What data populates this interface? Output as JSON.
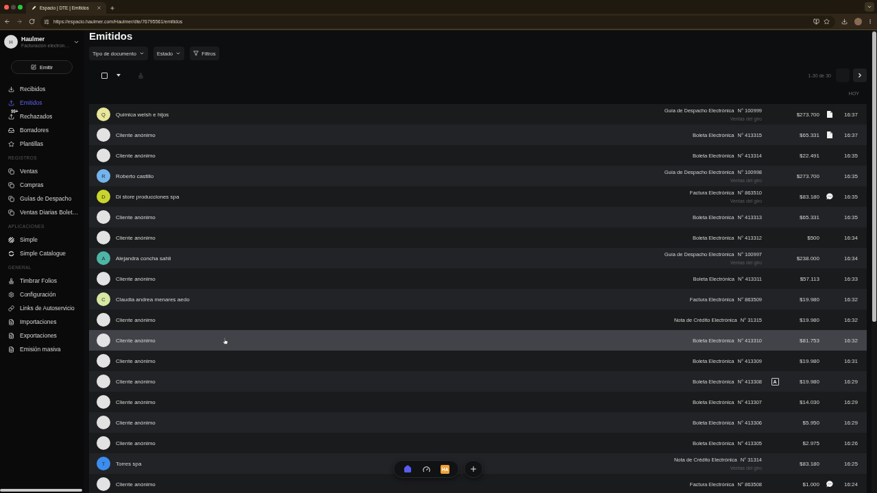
{
  "browser": {
    "tab_title": "Espacio | DTE | Emitidos",
    "url": "https://espacio.haulmer.com/Haulmer/dte/76795561/emitidos"
  },
  "sidebar": {
    "account": {
      "initial": "H",
      "name": "Haulmer",
      "subtitle": "Facturación electrón…"
    },
    "compose_button": "Emitir",
    "sections": [
      {
        "items": [
          {
            "label": "Recibidos",
            "selected": false
          },
          {
            "label": "Emitidos",
            "selected": true
          },
          {
            "label": "Rechazados",
            "selected": false,
            "badge": "99+"
          },
          {
            "label": "Borradores",
            "selected": false
          },
          {
            "label": "Plantillas",
            "selected": false
          }
        ]
      },
      {
        "title": "REGISTROS",
        "items": [
          {
            "label": "Ventas",
            "selected": false
          },
          {
            "label": "Compras",
            "selected": false
          },
          {
            "label": "Guías de Despacho",
            "selected": false
          },
          {
            "label": "Ventas Diarias Bolet…",
            "selected": false
          }
        ]
      },
      {
        "title": "APLICACIONES",
        "items": [
          {
            "label": "Simple",
            "selected": false
          },
          {
            "label": "Simple Catalogue",
            "selected": false
          }
        ]
      },
      {
        "title": "GENERAL",
        "items": [
          {
            "label": "Timbrar Folios",
            "selected": false
          },
          {
            "label": "Configuración",
            "selected": false
          },
          {
            "label": "Links de Autoservicio",
            "selected": false
          },
          {
            "label": "Importaciones",
            "selected": false
          },
          {
            "label": "Exportaciones",
            "selected": false
          },
          {
            "label": "Emisión masiva",
            "selected": false
          }
        ]
      }
    ]
  },
  "page": {
    "title": "Emitidos",
    "filters": [
      {
        "label": "Tipo de documento",
        "kind": "dropdown"
      },
      {
        "label": "Estado",
        "kind": "dropdown"
      },
      {
        "label": "Filtros",
        "kind": "filter"
      }
    ],
    "select_all": {
      "checked": false
    },
    "pagination": {
      "range": "1-30 de 30",
      "previous": {
        "disabled": true
      },
      "next": {
        "disabled": false
      }
    },
    "day_label": "HOY",
    "rows": [
      {
        "avatar": {
          "initial": "Q",
          "color": "#e8e79a"
        },
        "name": "Quimica welsh e hijos",
        "document": "Guía de Despacho Electrónica",
        "number": "N° 100999",
        "detail": "Ventas del giro",
        "amount": "$273.700",
        "indicator": {
          "kind": "document"
        },
        "time": "16:37",
        "hovered": false
      },
      {
        "avatar": {
          "color": "#e2e2e2"
        },
        "name": "Cliente anónimo",
        "document": "Boleta Electrónica",
        "number": "N° 413315",
        "amount": "$65.331",
        "indicator": {
          "kind": "document"
        },
        "time": "16:37",
        "hovered": false
      },
      {
        "avatar": {
          "color": "#e2e2e2"
        },
        "name": "Cliente anónimo",
        "document": "Boleta Electrónica",
        "number": "N° 413314",
        "amount": "$22.491",
        "time": "16:35",
        "hovered": false
      },
      {
        "avatar": {
          "initial": "R",
          "color": "#74b4ee"
        },
        "name": "Roberto castillo",
        "document": "Guía de Despacho Electrónica",
        "number": "N° 100998",
        "detail": "Ventas del giro",
        "amount": "$273.700",
        "time": "16:35",
        "hovered": false
      },
      {
        "avatar": {
          "initial": "D",
          "color": "#c9d52e"
        },
        "name": "Di store producciones spa",
        "document": "Factura Electrónica",
        "number": "N° 863510",
        "detail": "Ventas del giro",
        "amount": "$83.180",
        "indicator": {
          "kind": "chat"
        },
        "time": "16:35",
        "hovered": false
      },
      {
        "avatar": {
          "color": "#e2e2e2"
        },
        "name": "Cliente anónimo",
        "document": "Boleta Electrónica",
        "number": "N° 413313",
        "amount": "$65.331",
        "time": "16:35",
        "hovered": false
      },
      {
        "avatar": {
          "color": "#e2e2e2"
        },
        "name": "Cliente anónimo",
        "document": "Boleta Electrónica",
        "number": "N° 413312",
        "amount": "$500",
        "time": "16:34",
        "hovered": false
      },
      {
        "avatar": {
          "initial": "A",
          "color": "#4db6a6"
        },
        "name": "Alejandra concha sahli",
        "document": "Guía de Despacho Electrónica",
        "number": "N° 100997",
        "detail": "Ventas del giro",
        "amount": "$238.000",
        "time": "16:34",
        "hovered": false
      },
      {
        "avatar": {
          "color": "#e2e2e2"
        },
        "name": "Cliente anónimo",
        "document": "Boleta Electrónica",
        "number": "N° 413311",
        "amount": "$57.113",
        "time": "16:33",
        "hovered": false
      },
      {
        "avatar": {
          "initial": "C",
          "color": "#d6e8a2"
        },
        "name": "Claudia andrea menares aedo",
        "document": "Factura Electrónica",
        "number": "N° 863509",
        "amount": "$19.980",
        "time": "16:32",
        "hovered": false
      },
      {
        "avatar": {
          "color": "#e2e2e2"
        },
        "name": "Cliente anónimo",
        "document": "Nota de Crédito Electrónica",
        "number": "N° 31315",
        "amount": "$19.980",
        "time": "16:32",
        "hovered": false
      },
      {
        "avatar": {
          "color": "#e2e2e2"
        },
        "name": "Cliente anónimo",
        "document": "Boleta Electrónica",
        "number": "N° 413310",
        "amount": "$81.753",
        "time": "16:32",
        "hovered": true
      },
      {
        "avatar": {
          "color": "#e2e2e2"
        },
        "name": "Cliente anónimo",
        "document": "Boleta Electrónica",
        "number": "N° 413309",
        "amount": "$19.980",
        "time": "16:31",
        "hovered": false
      },
      {
        "avatar": {
          "color": "#e2e2e2"
        },
        "name": "Cliente anónimo",
        "document": "Boleta Electrónica",
        "number": "N° 413308",
        "badge": "A",
        "amount": "$19.980",
        "time": "16:29",
        "hovered": false
      },
      {
        "avatar": {
          "color": "#e2e2e2"
        },
        "name": "Cliente anónimo",
        "document": "Boleta Electrónica",
        "number": "N° 413307",
        "amount": "$14.030",
        "time": "16:29",
        "hovered": false
      },
      {
        "avatar": {
          "color": "#e2e2e2"
        },
        "name": "Cliente anónimo",
        "document": "Boleta Electrónica",
        "number": "N° 413306",
        "amount": "$5.950",
        "time": "16:29",
        "hovered": false
      },
      {
        "avatar": {
          "color": "#e2e2e2"
        },
        "name": "Cliente anónimo",
        "document": "Boleta Electrónica",
        "number": "N° 413305",
        "amount": "$2.975",
        "time": "16:26",
        "hovered": false
      },
      {
        "avatar": {
          "initial": "T",
          "color": "#3b8ef0"
        },
        "name": "Torres spa",
        "document": "Nota de Crédito Electrónica",
        "number": "N° 31314",
        "detail": "Ventas del giro",
        "amount": "$83.180",
        "time": "16:25",
        "hovered": false
      },
      {
        "avatar": {
          "color": "#e2e2e2"
        },
        "name": "Cliente anónimo",
        "document": "Factura Electrónica",
        "number": "N° 863508",
        "amount": "$1.000",
        "indicator": {
          "kind": "chat"
        },
        "time": "16:24",
        "hovered": false
      }
    ]
  },
  "dock": {
    "items": [
      {
        "kind": "home",
        "selected": true
      },
      {
        "kind": "gauge",
        "selected": false
      },
      {
        "kind": "app",
        "label": "HA",
        "selected": false
      }
    ]
  }
}
